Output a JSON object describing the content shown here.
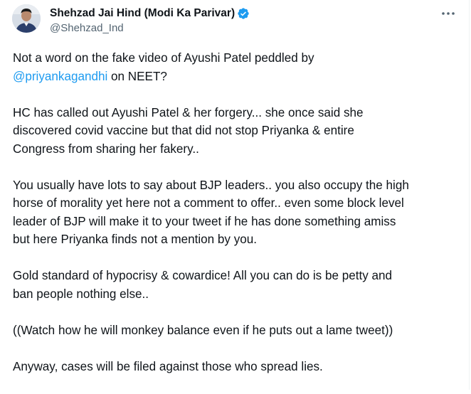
{
  "user": {
    "display_name": "Shehzad Jai Hind (Modi Ka Parivar)",
    "handle": "@Shehzad_Ind"
  },
  "icons": {
    "verified": "verified-badge-icon",
    "more": "more-options-icon"
  },
  "colors": {
    "accent": "#1d9bf0",
    "text": "#0f1419",
    "secondary": "#536471"
  },
  "tweet": {
    "p1_line1": "Not a word on the fake video of Ayushi Patel peddled by",
    "p1_mention": "@priyankagandhi",
    "p1_after": " on NEET?",
    "p2_line1": "HC has called out Ayushi Patel & her forgery... she once said she",
    "p2_line2": "discovered covid vaccine but that did not stop Priyanka & entire",
    "p2_line3": "Congress from sharing her fakery..",
    "p3_line1": "You usually have lots to say about BJP leaders.. you also occupy the high",
    "p3_line2": "horse of morality yet here not a comment to offer.. even some block level",
    "p3_line3": "leader of BJP will make it to your tweet if he has done something amiss",
    "p3_line4": "but here Priyanka finds not a mention by you.",
    "p4_line1": "Gold standard of hypocrisy & cowardice! All you can do is be petty and",
    "p4_line2": "ban people nothing else..",
    "p5_line1": "((Watch how he will monkey balance even if he puts out a lame tweet))",
    "p6_line1": "Anyway, cases will be filed against those who spread lies."
  }
}
